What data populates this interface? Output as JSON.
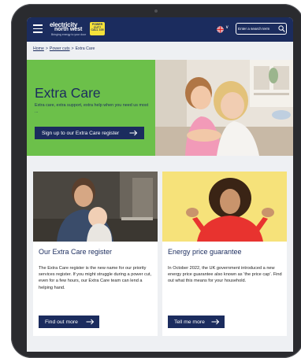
{
  "header": {
    "logo_line1": "electricity",
    "logo_line2": "north west",
    "logo_tagline": "Bringing energy to your door",
    "badge_text": "POWER CUT? CALL 105",
    "search_placeholder": "Enter a search term",
    "icons": {
      "menu": "hamburger-menu-icon",
      "flag": "uk-flag-icon",
      "chevron": "chevron-down-icon",
      "search": "search-icon"
    }
  },
  "breadcrumb": {
    "home": "Home",
    "power_cuts": "Power cuts",
    "current": "Extra Care",
    "separator": ">"
  },
  "hero": {
    "title": "Extra Care",
    "description": "Extra care, extra support, extra help when you need us most ...",
    "button_label": "Sign up to our Extra Care register"
  },
  "cards": [
    {
      "title": "Our Extra Care register",
      "body": "The Extra Care register is the new name for our priority services register. If you might struggle during a power cut, even for a few hours, our Extra Care team can lend a helping hand.",
      "button_label": "Find out more"
    },
    {
      "title": "Energy price guarantee",
      "body": "In October 2022, the UK government introduced a new energy price guarantee also known as ‘the price cap’. Find out what this means for your household.",
      "button_label": "Tell me more"
    }
  ],
  "colors": {
    "navy": "#1b2c5e",
    "green": "#6cc04a",
    "yellow": "#f5e23a",
    "background": "#eef0f3"
  }
}
